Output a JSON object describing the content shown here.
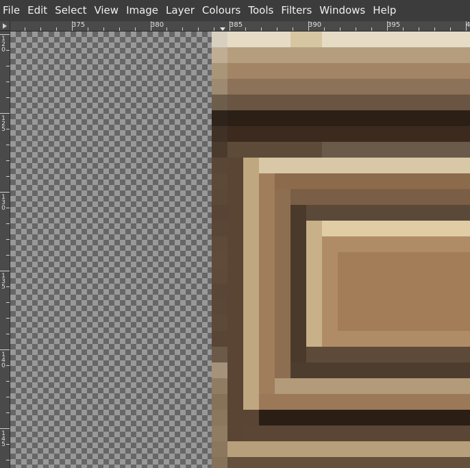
{
  "menubar": {
    "items": [
      "File",
      "Edit",
      "Select",
      "View",
      "Image",
      "Layer",
      "Colours",
      "Tools",
      "Filters",
      "Windows",
      "Help"
    ]
  },
  "ruler": {
    "h_labels": [
      "375",
      "380",
      "385",
      "390",
      "395",
      "4"
    ],
    "v_labels": [
      [
        "1",
        "2",
        "0"
      ],
      [
        "1",
        "2",
        "5"
      ],
      [
        "1",
        "3",
        "0"
      ],
      [
        "1",
        "3",
        "5"
      ],
      [
        "1",
        "4",
        "0"
      ],
      [
        "1",
        "4",
        "5"
      ]
    ]
  },
  "colors": {
    "chrome_bg": "#3c3c3c",
    "ruler_bg": "#4a4a4a",
    "checker_light": "#999999",
    "checker_dark": "#666666"
  }
}
